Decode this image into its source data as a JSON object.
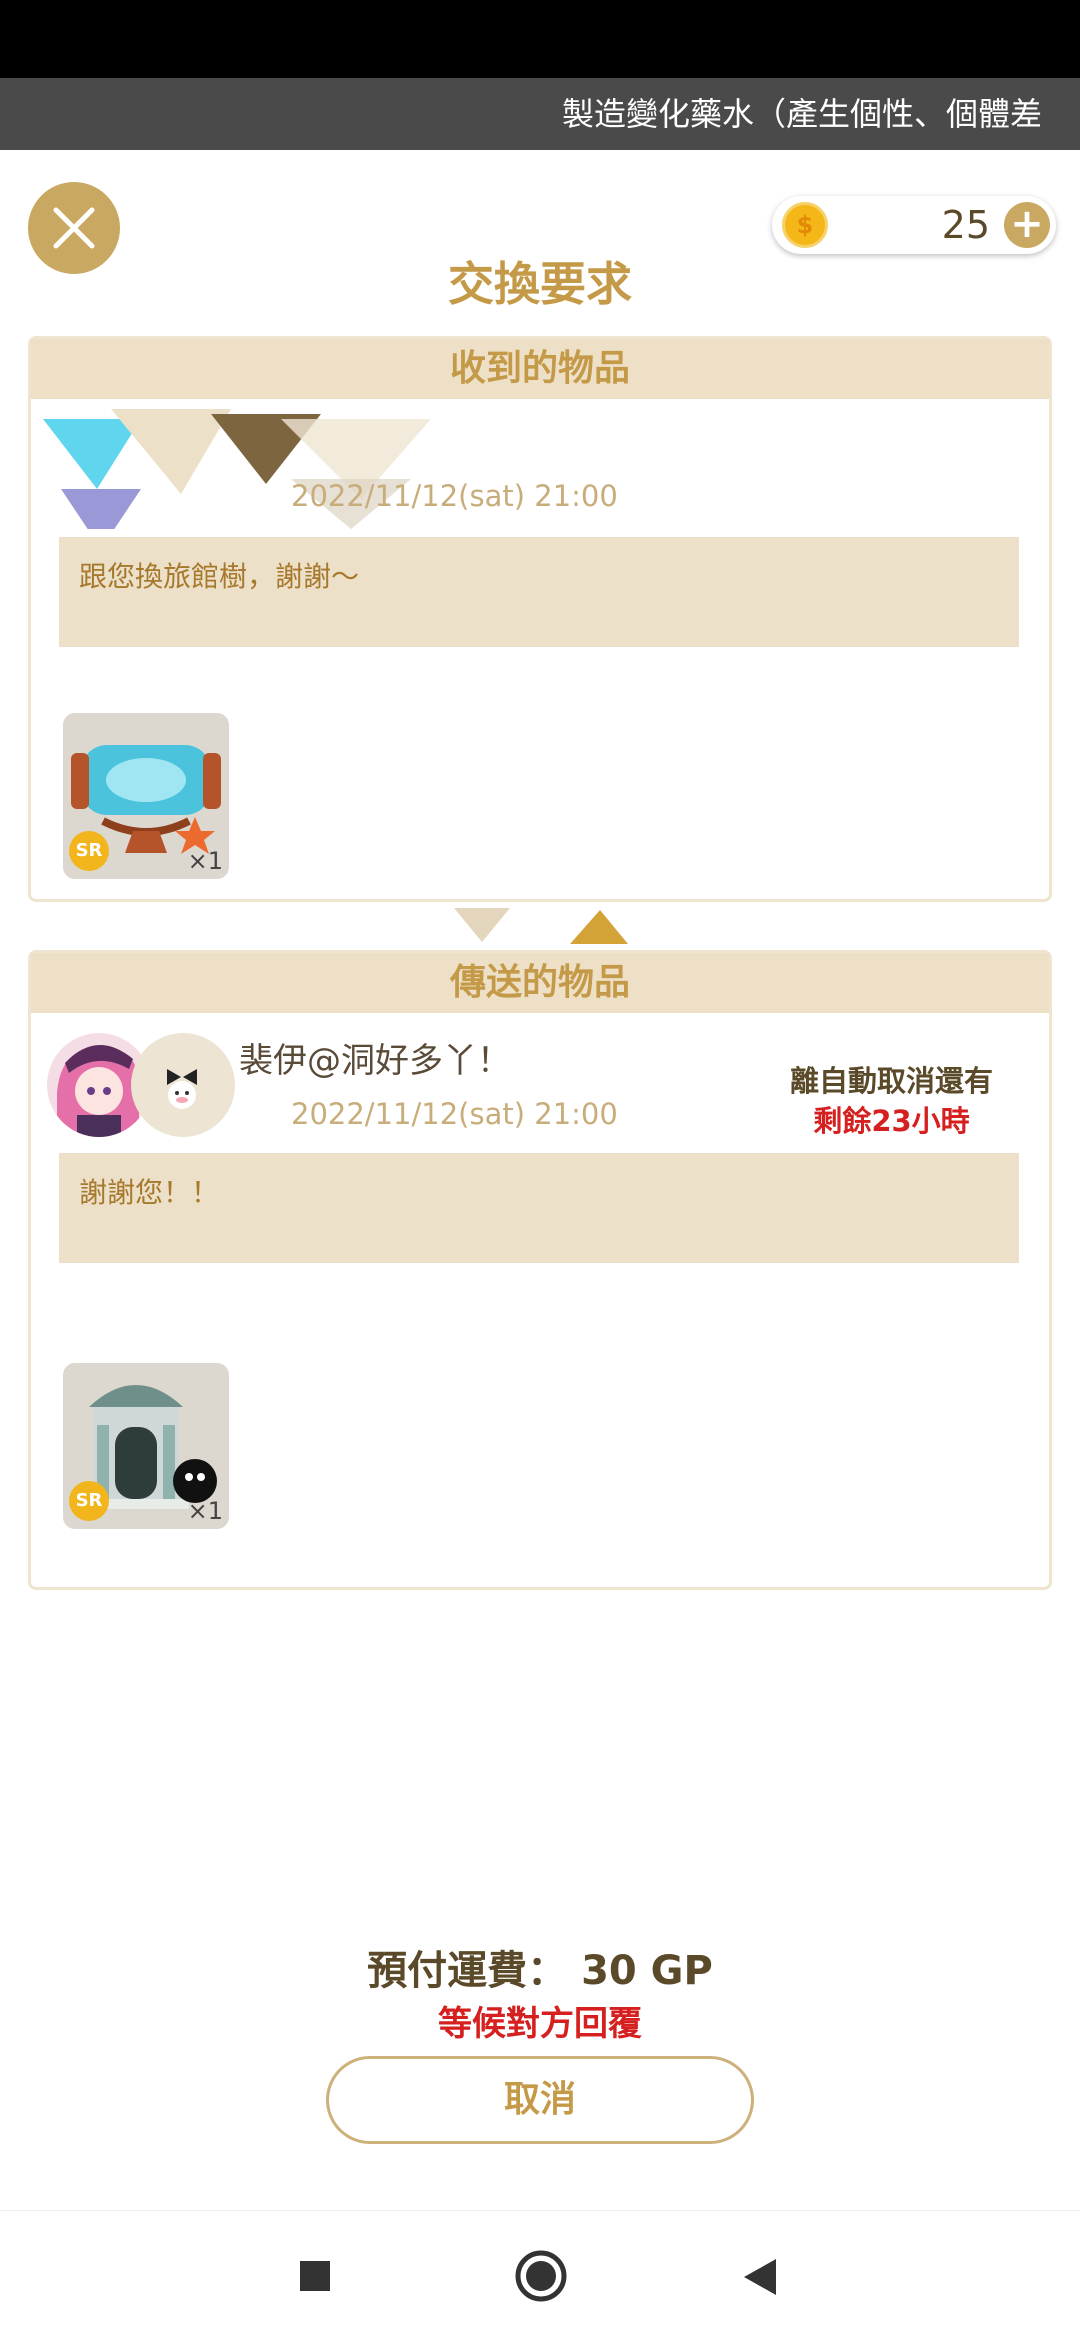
{
  "ticker": {
    "text": "製造變化藥水（產生個性、個體差"
  },
  "coins": {
    "count": "25",
    "plus": "+"
  },
  "header": {
    "title": "交換要求"
  },
  "received": {
    "heading": "收到的物品",
    "date": "2022/11/12(sat) 21:00",
    "message": "跟您換旅館樹，謝謝～",
    "item": {
      "rarity": "SR",
      "quantity": "×1",
      "icon": "aquarium-furniture-icon"
    }
  },
  "sent": {
    "heading": "傳送的物品",
    "sender": "裴伊@洞好多丫！",
    "date": "2022/11/12(sat) 21:00",
    "auto_cancel_label": "離自動取消還有",
    "remaining": "剩餘23小時",
    "message": "謝謝您！！",
    "item": {
      "rarity": "SR",
      "quantity": "×1",
      "icon": "hotel-building-icon"
    }
  },
  "footer": {
    "fee_label": "預付運費：",
    "fee_value": "30 GP",
    "status": "等候對方回覆",
    "cancel_label": "取消"
  },
  "colors": {
    "accent": "#c49a48",
    "warning": "#d62020",
    "panel_bg": "#eee0c7"
  },
  "nav": {
    "icons": [
      "recent-apps-icon",
      "home-icon",
      "back-icon"
    ]
  }
}
